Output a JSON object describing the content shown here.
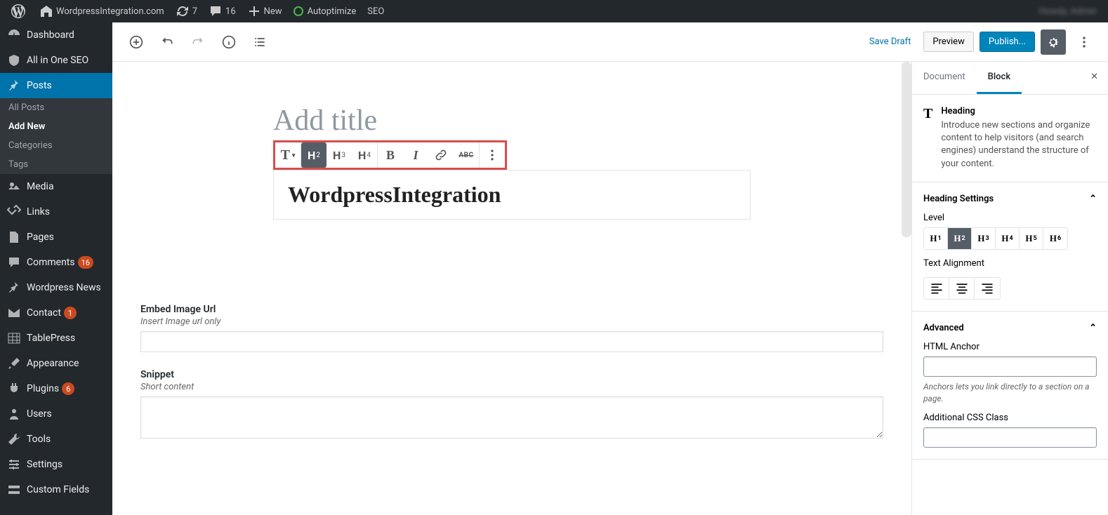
{
  "adminbar": {
    "site_name": "WordpressIntegration.com",
    "updates": "7",
    "comments": "16",
    "new": "New",
    "autoptimize": "Autoptimize",
    "seo": "SEO",
    "user_greeting": "Howdy, Admin"
  },
  "sidebar": {
    "dashboard": "Dashboard",
    "aio_seo": "All in One SEO",
    "posts": "Posts",
    "posts_sub": {
      "all": "All Posts",
      "add_new": "Add New",
      "categories": "Categories",
      "tags": "Tags"
    },
    "media": "Media",
    "links": "Links",
    "pages": "Pages",
    "comments": "Comments",
    "comments_count": "16",
    "wp_news": "Wordpress News",
    "contact": "Contact",
    "contact_count": "1",
    "tablepress": "TablePress",
    "appearance": "Appearance",
    "plugins": "Plugins",
    "plugins_count": "6",
    "users": "Users",
    "tools": "Tools",
    "settings": "Settings",
    "custom_fields": "Custom Fields"
  },
  "editor_header": {
    "save_draft": "Save Draft",
    "preview": "Preview",
    "publish": "Publish..."
  },
  "editor": {
    "title_placeholder": "Add title",
    "heading_text": "WordpressIntegration"
  },
  "block_toolbar": {
    "transform": "T",
    "h2": "H",
    "h2s": "2",
    "h3": "H",
    "h3s": "3",
    "h4": "H",
    "h4s": "4",
    "bold": "B",
    "italic": "I",
    "strike": "ABC"
  },
  "meta": {
    "embed_label": "Embed Image Url",
    "embed_hint": "Insert Image url only",
    "snippet_label": "Snippet",
    "snippet_hint": "Short content"
  },
  "inspector": {
    "tab_doc": "Document",
    "tab_block": "Block",
    "block_name": "Heading",
    "block_help": "Introduce new sections and organize content to help visitors (and search engines) understand the structure of your content.",
    "heading_settings": "Heading Settings",
    "level_label": "Level",
    "levels": [
      "1",
      "2",
      "3",
      "4",
      "5",
      "6"
    ],
    "alignment_label": "Text Alignment",
    "advanced": "Advanced",
    "anchor_label": "HTML Anchor",
    "anchor_help": "Anchors lets you link directly to a section on a page.",
    "css_class_label": "Additional CSS Class"
  }
}
